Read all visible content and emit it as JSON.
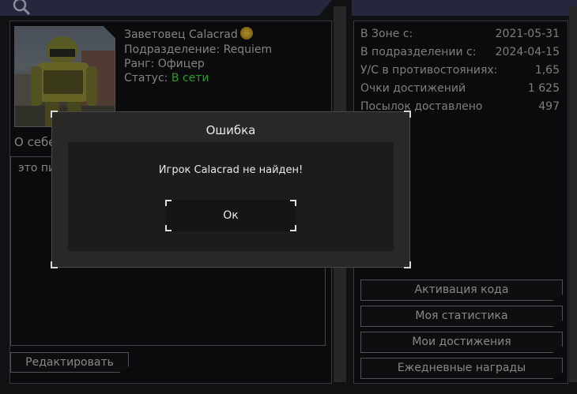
{
  "header": {
    "search_icon": "search-icon"
  },
  "profile": {
    "name": "Заветовец Calacrad",
    "subdivision": "Подразделение: Requiem",
    "rank": "Ранг: Офицер",
    "status_label": "Статус: ",
    "status_value": "В сети",
    "about_label": "О себе",
    "about_text": "это пи"
  },
  "buttons": {
    "edit": "Редактировать",
    "activate_code": "Активация кода",
    "my_stats": "Моя статистика",
    "my_achievements": "Мои достижения",
    "daily_rewards": "Ежедневные награды"
  },
  "stats": [
    {
      "label": "В Зоне с:",
      "value": "2021-05-31"
    },
    {
      "label": "В подразделении с:",
      "value": "2024-04-15"
    },
    {
      "label": "У/С в противостояниях:",
      "value": "1,65"
    },
    {
      "label": "Очки достижений",
      "value": "1 625"
    },
    {
      "label": "Посылок доставлено",
      "value": "497"
    }
  ],
  "dialog": {
    "title": "Ошибка",
    "message": "Игрок Calacrad не найден!",
    "ok": "Ок"
  },
  "colors": {
    "header": "#3a3d5e",
    "online": "#3ef03e"
  }
}
